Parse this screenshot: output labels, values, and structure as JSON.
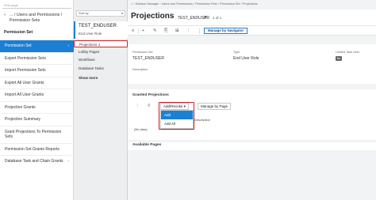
{
  "nav": {
    "search_placeholder": "Find page",
    "back_glyph": "‹",
    "path": "... / Users and Permissions / Permission Sets",
    "group_title": "Permission Set",
    "items": [
      {
        "label": "Permission Set",
        "active": true
      },
      {
        "label": "Export Permission Sets"
      },
      {
        "label": "Import Permission Sets"
      },
      {
        "label": "Export All User Grants"
      },
      {
        "label": "Import All User Grants"
      },
      {
        "label": "Projection Grants"
      },
      {
        "label": "Projection Summary"
      },
      {
        "label": "Grant Projections To Permission Sets"
      },
      {
        "label": "Permission Set Grants Reports"
      },
      {
        "label": "Database Task and Chain Grants"
      }
    ],
    "chevron_glyph": "›"
  },
  "records": {
    "sort_label": "Sort by",
    "sort_caret": "▾",
    "current": {
      "name": "TEST_ENDUSER",
      "type": "End User Role"
    },
    "links": [
      {
        "label": "Projections 4",
        "selected": true
      },
      {
        "label": "Lobby Pages"
      },
      {
        "label": "Workflows"
      },
      {
        "label": "Database Tasks"
      }
    ],
    "show_more": "Show more"
  },
  "main": {
    "breadcrumb": {
      "home_glyph": "⌂",
      "trail": "›  Solution Manager  ›  Users and Permissions  ›  Permission Sets  ›  Permission Set  ›  Projections"
    },
    "title": "Projections",
    "record_name": "TEST_ENDUSER",
    "record_caret": "▾",
    "record_count": "1 of 1",
    "toolbar": {
      "icons": [
        "≡",
        "+",
        "✎",
        "⎘",
        "⊞",
        "⋮"
      ],
      "manage_button": "Manage by Navigator"
    },
    "details": {
      "permission_set_label": "Permission Set",
      "permission_set_value": "TEST_ENDUSER",
      "type_label": "Type",
      "type_value": "End User Role",
      "limited_label": "Limited Task User",
      "limited_value": "No",
      "description_label": "Description"
    },
    "granted": {
      "title": "Granted Projections",
      "filter_icon": "⫶",
      "funnel_icon": "⚲",
      "add_revoke": "Add/Revoke",
      "add_revoke_caret": "▾",
      "manage_by_page": "Manage by Page",
      "menu": [
        "Add",
        "Add All"
      ],
      "col_header": "Description",
      "no_data": "(No data)"
    },
    "available_title": "Available Pages"
  }
}
